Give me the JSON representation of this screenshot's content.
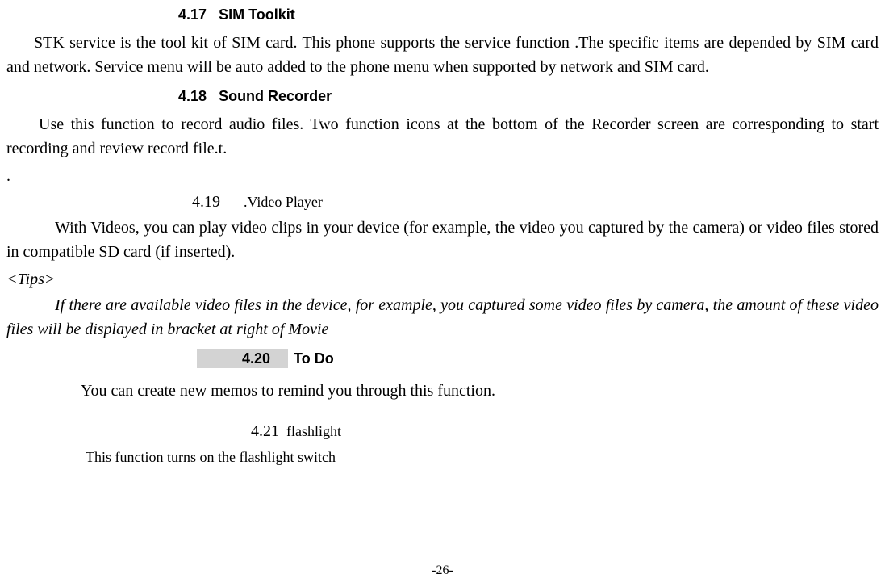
{
  "sections": {
    "s417": {
      "num": "4.17",
      "title": "SIM Toolkit",
      "body": "STK service is the tool kit of SIM card. This phone supports the service function .The specific items are depended by SIM card and network. Service menu will be auto added to the phone menu when supported by network and SIM card."
    },
    "s418": {
      "num": "4.18",
      "title": "Sound Recorder",
      "body": "Use this function to record audio files. Two function icons at the bottom of the Recorder screen are corresponding to start recording and review record file.t.",
      "dot": "."
    },
    "s419": {
      "num": "4.19",
      "title": ".Video Player",
      "body": "With Videos, you can play video clips in your device (for example, the video you captured by the camera) or video files stored in compatible SD card (if inserted).",
      "tips_label": "<Tips>",
      "tips_body": "If there are available video files in the device, for example, you captured some video files by camera, the amount of these video files will be displayed in bracket at right of Movie"
    },
    "s420": {
      "num": "4.20",
      "title": "To Do",
      "body": "You can create new memos to remind you through this function."
    },
    "s421": {
      "num": "4.21",
      "title": "flashlight",
      "body": "This function turns on the flashlight switch"
    }
  },
  "page_number": "-26-"
}
